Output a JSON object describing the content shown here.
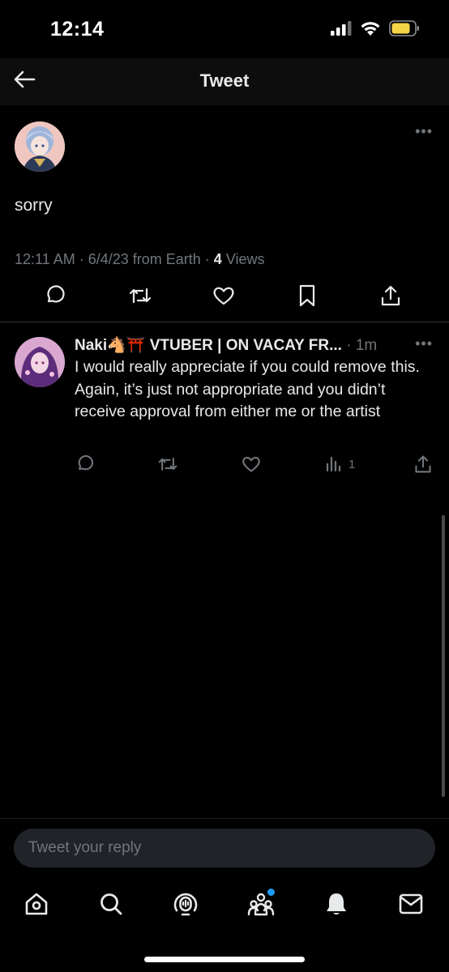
{
  "status_bar": {
    "time": "12:14",
    "icons": [
      "cellular-signal-icon",
      "wifi-icon",
      "battery-icon"
    ],
    "battery_color": "#f5d547"
  },
  "header": {
    "title": "Tweet",
    "back_icon": "arrow-left-icon"
  },
  "main_tweet": {
    "author_name": "",
    "text": "sorry",
    "meta_time_date_source": "12:11 AM · 6/4/23 from Earth · ",
    "views_count": "4",
    "views_label": " Views",
    "actions": [
      "reply-icon",
      "retweet-icon",
      "like-icon",
      "bookmark-icon",
      "share-icon"
    ]
  },
  "reply": {
    "display_name": "Naki🐴⛩️ VTUBER | ON VACAY FR...",
    "time": " · 1m",
    "text": "I would really appreciate if you could remove this. Again, it’s just not appropriate and you didn’t receive approval from either me or the artist",
    "views_count": "1",
    "actions": [
      "reply-icon",
      "retweet-icon",
      "like-icon",
      "views-icon",
      "share-icon"
    ]
  },
  "composer": {
    "placeholder": "Tweet your reply"
  },
  "bottom_nav": {
    "items": [
      "home-icon",
      "search-icon",
      "spaces-icon",
      "communities-icon",
      "notifications-icon",
      "messages-icon"
    ],
    "dot_color": "#1d9bf0"
  },
  "colors": {
    "background": "#000000",
    "text_primary": "#e7e9ea",
    "text_secondary": "#71767b",
    "divider": "#2f3336",
    "accent": "#1d9bf0"
  }
}
